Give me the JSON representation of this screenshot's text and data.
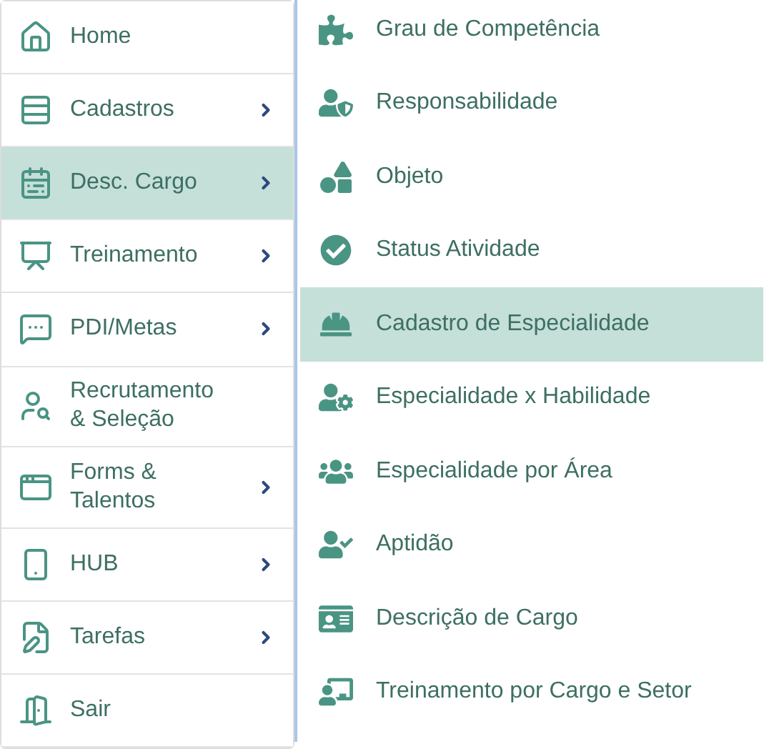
{
  "menu": {
    "items": [
      {
        "label": "Home",
        "selected": false,
        "has_submenu": false
      },
      {
        "label": "Cadastros",
        "selected": false,
        "has_submenu": true
      },
      {
        "label": "Desc. Cargo",
        "selected": true,
        "has_submenu": true
      },
      {
        "label": "Treinamento",
        "selected": false,
        "has_submenu": true
      },
      {
        "label": "PDI/Metas",
        "selected": false,
        "has_submenu": true
      },
      {
        "label": "Recrutamento & Seleção",
        "selected": false,
        "has_submenu": false
      },
      {
        "label": "Forms & Talentos",
        "selected": false,
        "has_submenu": true
      },
      {
        "label": "HUB",
        "selected": false,
        "has_submenu": true
      },
      {
        "label": "Tarefas",
        "selected": false,
        "has_submenu": true
      },
      {
        "label": "Sair",
        "selected": false,
        "has_submenu": false
      }
    ]
  },
  "submenu": {
    "items": [
      {
        "label": "Grau de Competência",
        "selected": false
      },
      {
        "label": "Responsabilidade",
        "selected": false
      },
      {
        "label": "Objeto",
        "selected": false
      },
      {
        "label": "Status Atividade",
        "selected": false
      },
      {
        "label": "Cadastro de Especialidade",
        "selected": true
      },
      {
        "label": "Especialidade x Habilidade",
        "selected": false
      },
      {
        "label": "Especialidade por Área",
        "selected": false
      },
      {
        "label": "Aptidão",
        "selected": false
      },
      {
        "label": "Descrição de Cargo",
        "selected": false
      },
      {
        "label": "Treinamento por Cargo e Setor",
        "selected": false
      }
    ]
  }
}
